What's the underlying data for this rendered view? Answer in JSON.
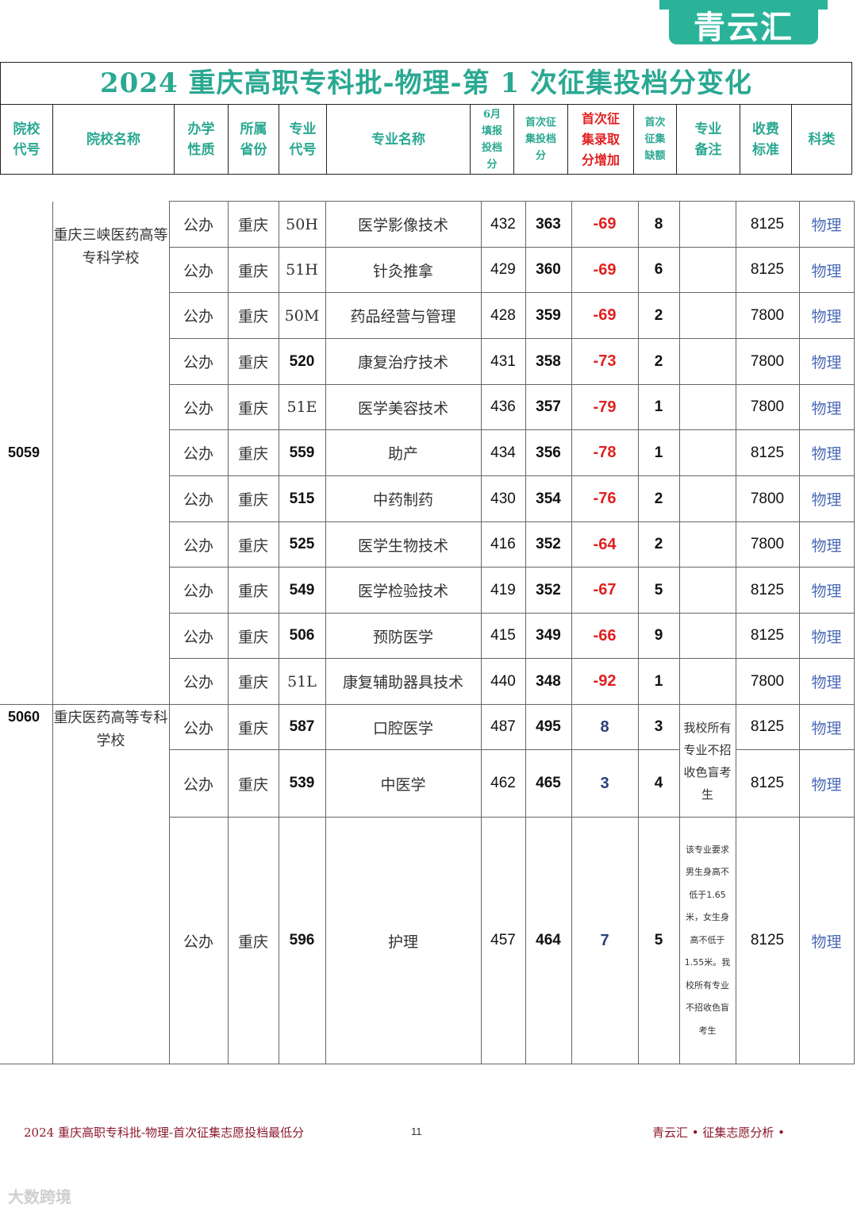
{
  "brand": {
    "logo_text": "青云汇",
    "watermark": "大数跨境"
  },
  "title": "2024 重庆高职专科批-物理-第 1 次征集投档分变化",
  "headers": {
    "school_code": "院校代号",
    "school_name": "院校名称",
    "nature": "办学性质",
    "province": "所属省份",
    "major_code": "专业代号",
    "major_name": "专业名称",
    "june_score": "6月填报投档分",
    "first_score": "首次征集投档分",
    "increase": "首次征集录取分增加",
    "vacancy": "首次征集缺额",
    "remark": "专业备注",
    "fee": "收费标准",
    "subject": "科类"
  },
  "schools": [
    {
      "code": "5059",
      "name": "重庆三峡医药高等专科学校",
      "rows": [
        {
          "nature": "公办",
          "province": "重庆",
          "major_code": "50H",
          "major": "医学影像技术",
          "june": "432",
          "first": "363",
          "inc": "-69",
          "vac": "8",
          "fee": "8125",
          "subject": "物理"
        },
        {
          "nature": "公办",
          "province": "重庆",
          "major_code": "51H",
          "major": "针灸推拿",
          "june": "429",
          "first": "360",
          "inc": "-69",
          "vac": "6",
          "fee": "8125",
          "subject": "物理"
        },
        {
          "nature": "公办",
          "province": "重庆",
          "major_code": "50M",
          "major": "药品经营与管理",
          "june": "428",
          "first": "359",
          "inc": "-69",
          "vac": "2",
          "fee": "7800",
          "subject": "物理"
        },
        {
          "nature": "公办",
          "province": "重庆",
          "major_code": "520",
          "major": "康复治疗技术",
          "june": "431",
          "first": "358",
          "inc": "-73",
          "vac": "2",
          "fee": "7800",
          "subject": "物理"
        },
        {
          "nature": "公办",
          "province": "重庆",
          "major_code": "51E",
          "major": "医学美容技术",
          "june": "436",
          "first": "357",
          "inc": "-79",
          "vac": "1",
          "fee": "7800",
          "subject": "物理"
        },
        {
          "nature": "公办",
          "province": "重庆",
          "major_code": "559",
          "major": "助产",
          "june": "434",
          "first": "356",
          "inc": "-78",
          "vac": "1",
          "fee": "8125",
          "subject": "物理"
        },
        {
          "nature": "公办",
          "province": "重庆",
          "major_code": "515",
          "major": "中药制药",
          "june": "430",
          "first": "354",
          "inc": "-76",
          "vac": "2",
          "fee": "7800",
          "subject": "物理"
        },
        {
          "nature": "公办",
          "province": "重庆",
          "major_code": "525",
          "major": "医学生物技术",
          "june": "416",
          "first": "352",
          "inc": "-64",
          "vac": "2",
          "fee": "7800",
          "subject": "物理"
        },
        {
          "nature": "公办",
          "province": "重庆",
          "major_code": "549",
          "major": "医学检验技术",
          "june": "419",
          "first": "352",
          "inc": "-67",
          "vac": "5",
          "fee": "8125",
          "subject": "物理"
        },
        {
          "nature": "公办",
          "province": "重庆",
          "major_code": "506",
          "major": "预防医学",
          "june": "415",
          "first": "349",
          "inc": "-66",
          "vac": "9",
          "fee": "8125",
          "subject": "物理"
        },
        {
          "nature": "公办",
          "province": "重庆",
          "major_code": "51L",
          "major": "康复辅助器具技术",
          "june": "440",
          "first": "348",
          "inc": "-92",
          "vac": "1",
          "fee": "7800",
          "subject": "物理"
        }
      ]
    },
    {
      "code": "5060",
      "name": "重庆医药高等专科学校",
      "rows": [
        {
          "nature": "公办",
          "province": "重庆",
          "major_code": "587",
          "major": "口腔医学",
          "june": "487",
          "first": "495",
          "inc": "8",
          "vac": "3",
          "fee": "8125",
          "subject": "物理"
        },
        {
          "nature": "公办",
          "province": "重庆",
          "major_code": "539",
          "major": "中医学",
          "june": "462",
          "first": "465",
          "inc": "3",
          "vac": "4",
          "fee": "8125",
          "subject": "物理"
        },
        {
          "nature": "公办",
          "province": "重庆",
          "major_code": "596",
          "major": "护理",
          "june": "457",
          "first": "464",
          "inc": "7",
          "vac": "5",
          "fee": "8125",
          "subject": "物理"
        }
      ],
      "remark_group": "我校所有专业不招收色盲考生",
      "remark_nursing": "该专业要求男生身高不低于1.65米，女生身高不低于1.55米。我校所有专业不招收色盲考生"
    }
  ],
  "footer": {
    "left": "2024 重庆高职专科批-物理-首次征集志愿投档最低分",
    "page": "11",
    "right": "青云汇 • 征集志愿分析 •"
  }
}
